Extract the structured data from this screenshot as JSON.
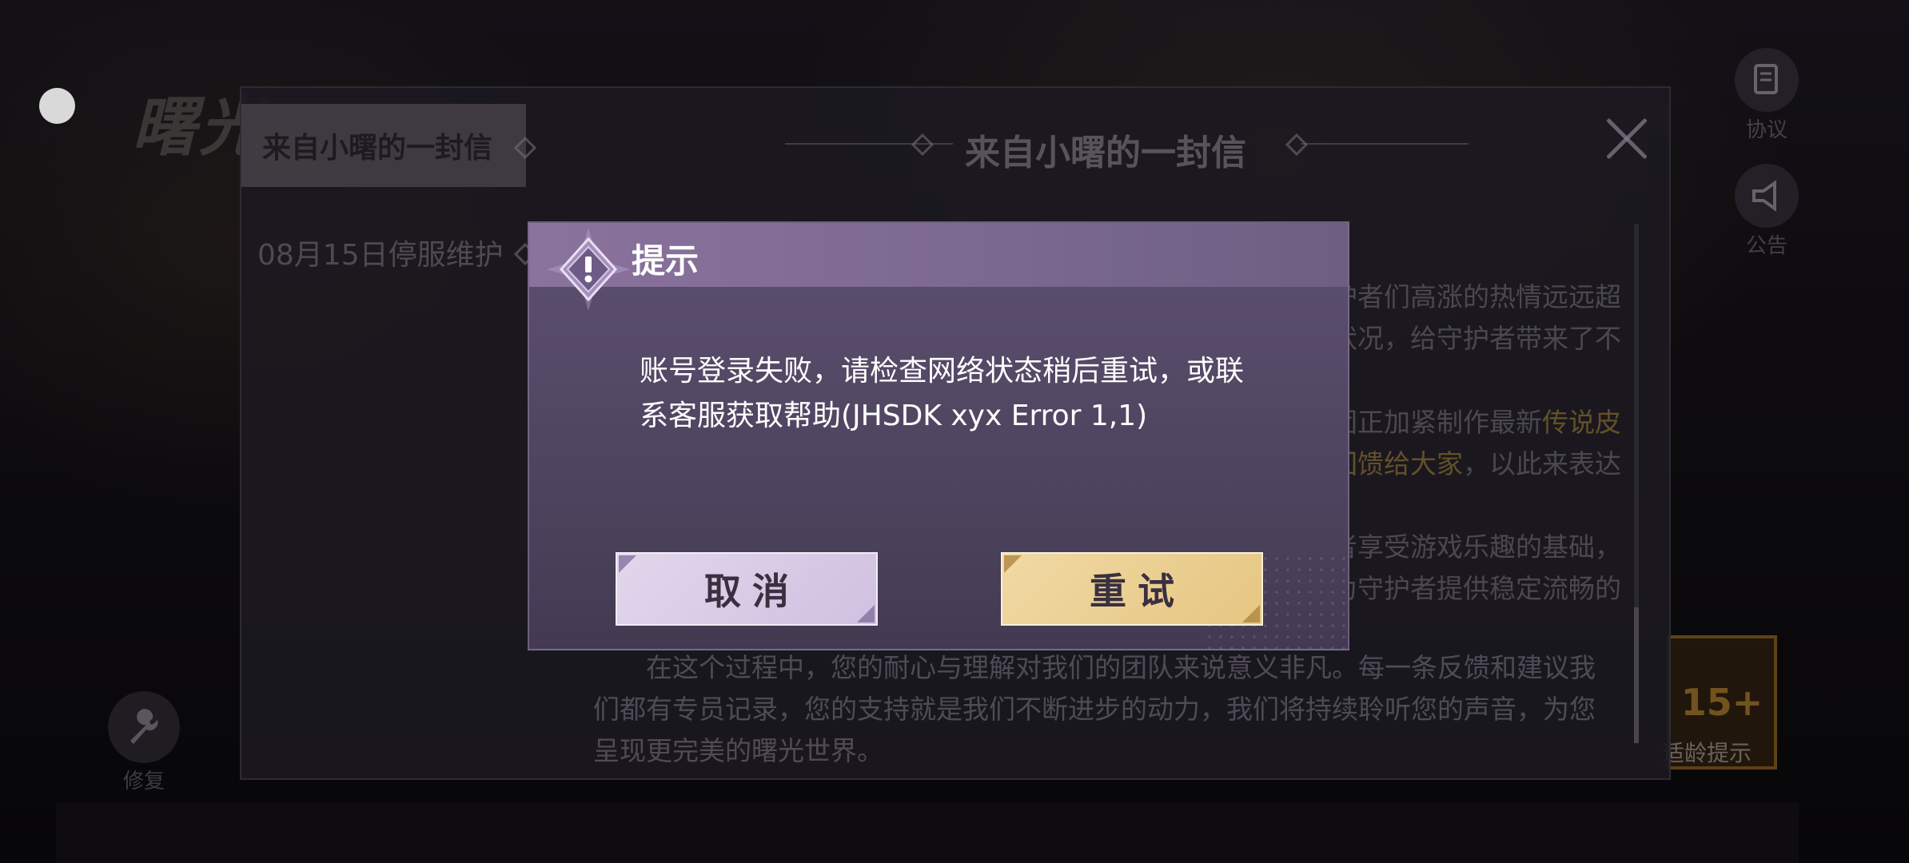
{
  "background": {
    "logo_text": "曙光",
    "repair_label": "修复",
    "protocol_label": "协议",
    "notice_label": "公告",
    "age_rating": "15+",
    "age_label": "适龄提示"
  },
  "letter": {
    "tab_active": "来自小曙的一封信",
    "tab_item": "08月15日停服维护",
    "title": "来自小曙的一封信",
    "frag1": "护者们高涨的热情远远超",
    "frag2": "状况，给守护者带来了不",
    "frag3_pre": "团正加紧制作最新",
    "frag3_hl": "传说皮",
    "frag4_hl": "回馈给大家",
    "frag4_post": "，以此来表达",
    "frag5": "者享受游戏乐趣的基础，",
    "frag6": "为守护者提供稳定流畅的",
    "para_bottom": "在这个过程中，您的耐心与理解对我们的团队来说意义非凡。每一条反馈和建议我们都有专员记录，您的支持就是我们不断进步的动力，我们将持续聆听您的声音，为您呈现更完美的曙光世界。"
  },
  "dialog": {
    "title": "提示",
    "message": "账号登录失败，请检查网络状态稍后重试，或联系客服获取帮助(JHSDK xyx Error 1,1)",
    "cancel_label": "取消",
    "retry_label": "重试"
  },
  "colors": {
    "dialog_header": "#8a739d",
    "dialog_body": "#4f4560",
    "cancel_button": "#d8cae6",
    "retry_button": "#ebcf92"
  },
  "icons": {
    "warning": "warning-diamond-icon",
    "close": "close-icon",
    "repair": "wrench-icon",
    "protocol": "document-icon",
    "notice": "megaphone-icon",
    "floating": "floating-ball-icon"
  }
}
